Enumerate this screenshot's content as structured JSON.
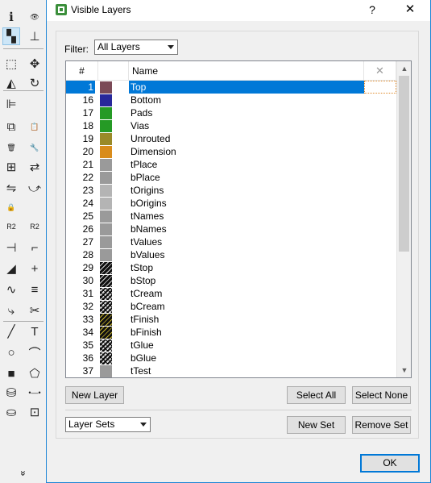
{
  "toolbar": {
    "tools": [
      {
        "name": "info-icon",
        "glyph": "ℹ"
      },
      {
        "name": "eye-icon",
        "glyph": "👁"
      },
      {
        "name": "layers-icon",
        "glyph": "▚"
      },
      {
        "name": "mark-icon",
        "glyph": "⊥"
      },
      {
        "name": "select-icon",
        "glyph": "⬚"
      },
      {
        "name": "move-icon",
        "glyph": "✥"
      },
      {
        "name": "mirror-icon",
        "glyph": "◭"
      },
      {
        "name": "rotate-icon",
        "glyph": "↻"
      },
      {
        "name": "align-icon",
        "glyph": "⊫"
      },
      {
        "name": "blank-icon",
        "glyph": ""
      },
      {
        "name": "copy-icon",
        "glyph": "⧉"
      },
      {
        "name": "paste-icon",
        "glyph": "📋"
      },
      {
        "name": "delete-icon",
        "glyph": "🗑"
      },
      {
        "name": "wrench-icon",
        "glyph": "🔧"
      },
      {
        "name": "add-icon",
        "glyph": "⊞"
      },
      {
        "name": "replace-icon",
        "glyph": "⇄"
      },
      {
        "name": "change-icon",
        "glyph": "⇋"
      },
      {
        "name": "pinswap-icon",
        "glyph": "⤻"
      },
      {
        "name": "lock-icon",
        "glyph": "🔒"
      },
      {
        "name": "blank2-icon",
        "glyph": ""
      },
      {
        "name": "name-icon",
        "glyph": "R2"
      },
      {
        "name": "value-icon",
        "glyph": "R2"
      },
      {
        "name": "split-icon",
        "glyph": "⊣"
      },
      {
        "name": "optimize-icon",
        "glyph": "⌐"
      },
      {
        "name": "miter-icon",
        "glyph": "◢"
      },
      {
        "name": "smash-icon",
        "glyph": "+"
      },
      {
        "name": "meander-icon",
        "glyph": "∿"
      },
      {
        "name": "split-trace-icon",
        "glyph": "≡"
      },
      {
        "name": "route-icon",
        "glyph": "⤷"
      },
      {
        "name": "ripup-icon",
        "glyph": "✂"
      },
      {
        "name": "line-icon",
        "glyph": "╱"
      },
      {
        "name": "text-icon",
        "glyph": "T"
      },
      {
        "name": "circle-icon",
        "glyph": "○"
      },
      {
        "name": "arc-icon",
        "glyph": "⌒"
      },
      {
        "name": "rect-icon",
        "glyph": "■"
      },
      {
        "name": "polygon-icon",
        "glyph": "⬠"
      },
      {
        "name": "via-icon",
        "glyph": "⛁"
      },
      {
        "name": "signal-icon",
        "glyph": "•—•"
      },
      {
        "name": "hole-icon",
        "glyph": "⛀"
      },
      {
        "name": "attribute-icon",
        "glyph": "⊡"
      },
      {
        "name": "dimension-icon",
        "glyph": "↔"
      },
      {
        "name": "blank3-icon",
        "glyph": ""
      }
    ],
    "more": "»"
  },
  "dialog": {
    "title": "Visible Layers",
    "help": "?",
    "close": "✕",
    "filter_label": "Filter:",
    "filter_value": "All Layers",
    "columns": {
      "num": "#",
      "name": "Name",
      "clear": "✕"
    },
    "layers": [
      {
        "num": "1",
        "name": "Top",
        "color": "#7b4a57",
        "pattern": "solid",
        "selected": true
      },
      {
        "num": "16",
        "name": "Bottom",
        "color": "#28289a",
        "pattern": "solid"
      },
      {
        "num": "17",
        "name": "Pads",
        "color": "#259a25",
        "pattern": "solid"
      },
      {
        "num": "18",
        "name": "Vias",
        "color": "#259a25",
        "pattern": "solid"
      },
      {
        "num": "19",
        "name": "Unrouted",
        "color": "#9a8a28",
        "pattern": "solid"
      },
      {
        "num": "20",
        "name": "Dimension",
        "color": "#d98c1c",
        "pattern": "solid"
      },
      {
        "num": "21",
        "name": "tPlace",
        "color": "#9a9a9a",
        "pattern": "solid"
      },
      {
        "num": "22",
        "name": "bPlace",
        "color": "#9a9a9a",
        "pattern": "solid"
      },
      {
        "num": "23",
        "name": "tOrigins",
        "color": "#b4b4b4",
        "pattern": "solid"
      },
      {
        "num": "24",
        "name": "bOrigins",
        "color": "#b4b4b4",
        "pattern": "solid"
      },
      {
        "num": "25",
        "name": "tNames",
        "color": "#9a9a9a",
        "pattern": "solid"
      },
      {
        "num": "26",
        "name": "bNames",
        "color": "#9a9a9a",
        "pattern": "solid"
      },
      {
        "num": "27",
        "name": "tValues",
        "color": "#9a9a9a",
        "pattern": "solid"
      },
      {
        "num": "28",
        "name": "bValues",
        "color": "#9a9a9a",
        "pattern": "solid"
      },
      {
        "num": "29",
        "name": "tStop",
        "color": "#1a1a1a",
        "pattern": "hatch"
      },
      {
        "num": "30",
        "name": "bStop",
        "color": "#1a1a1a",
        "pattern": "hatch"
      },
      {
        "num": "31",
        "name": "tCream",
        "color": "#1a1a1a",
        "pattern": "crosshatch"
      },
      {
        "num": "32",
        "name": "bCream",
        "color": "#1a1a1a",
        "pattern": "crosshatch"
      },
      {
        "num": "33",
        "name": "tFinish",
        "color": "#3a3a1a",
        "pattern": "hatch-yellow"
      },
      {
        "num": "34",
        "name": "bFinish",
        "color": "#3a3a1a",
        "pattern": "hatch-yellow"
      },
      {
        "num": "35",
        "name": "tGlue",
        "color": "#1a1a1a",
        "pattern": "crosshatch"
      },
      {
        "num": "36",
        "name": "bGlue",
        "color": "#1a1a1a",
        "pattern": "crosshatch"
      },
      {
        "num": "37",
        "name": "tTest",
        "color": "#9a9a9a",
        "pattern": "solid"
      }
    ],
    "new_layer": "New Layer",
    "select_all": "Select All",
    "select_none": "Select None",
    "layer_sets": "Layer Sets",
    "new_set": "New Set",
    "remove_set": "Remove Set",
    "ok": "OK"
  },
  "colors": {
    "accent": "#0078d7",
    "window_border": "#1e86d6"
  }
}
